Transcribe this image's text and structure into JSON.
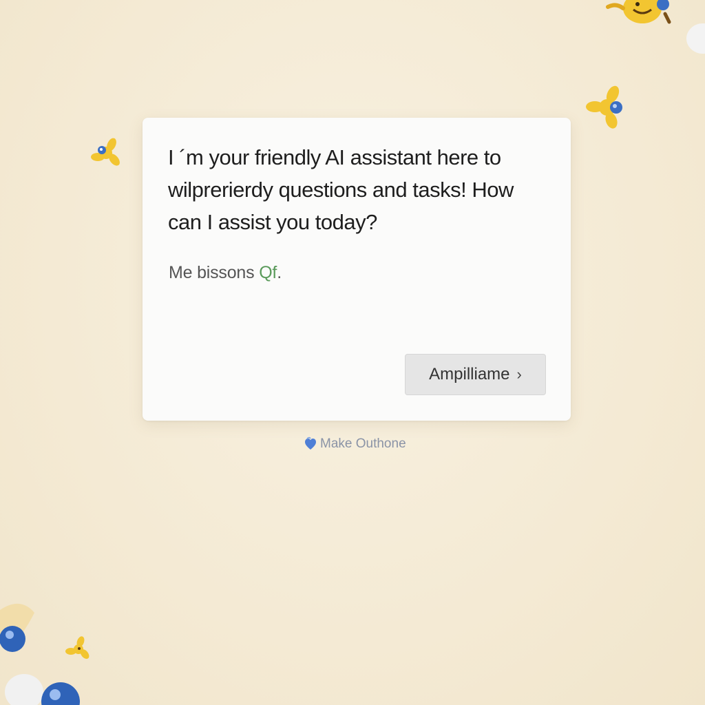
{
  "assistant_card": {
    "message": "I ´m your friendly AI assistant here to wilprerierdy questions and tasks! How can I assist you today?",
    "subline_prefix": "Me bissons ",
    "subline_accent": "Qf",
    "subline_suffix": ".",
    "action_button_label": "Ampilliame",
    "action_button_icon": "chevron-right-icon"
  },
  "footer": {
    "label": "Make Outhone",
    "icon": "heart-hand-icon"
  },
  "colors": {
    "background": "#f5ecd8",
    "card": "#fbfbfa",
    "button": "#e5e5e5",
    "accent_green": "#5a9a5a",
    "footer_text": "#8a93a6",
    "mascot_yellow": "#f2c531",
    "mascot_blue": "#3b6fc4"
  },
  "decorations": [
    "bee-mascot-icon",
    "flower-mascot-icon",
    "orb-mascot-icon"
  ]
}
